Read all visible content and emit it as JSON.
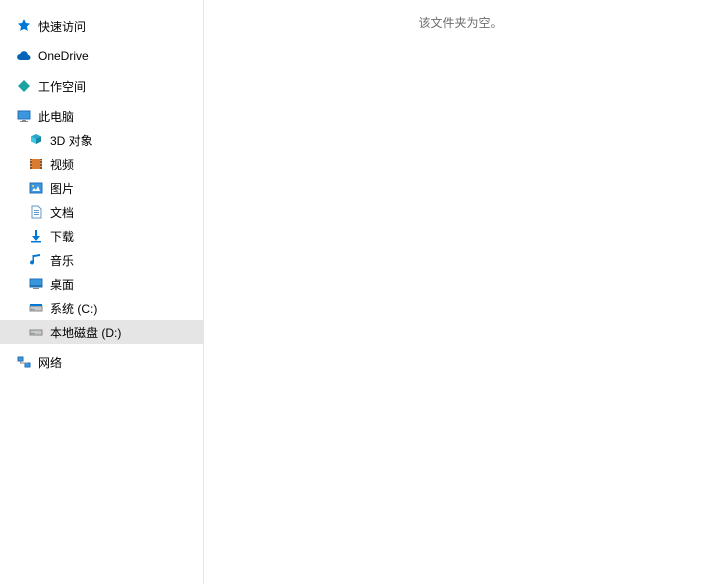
{
  "sidebar": {
    "quick_access": "快速访问",
    "onedrive": "OneDrive",
    "workspace": "工作空间",
    "this_pc": "此电脑",
    "this_pc_children": {
      "objects_3d": "3D 对象",
      "videos": "视频",
      "pictures": "图片",
      "documents": "文档",
      "downloads": "下载",
      "music": "音乐",
      "desktop": "桌面",
      "drive_c": "系统 (C:)",
      "drive_d": "本地磁盘 (D:)"
    },
    "network": "网络"
  },
  "main": {
    "empty_message": "该文件夹为空。"
  },
  "state": {
    "selected": "drive_d"
  },
  "colors": {
    "accent_blue": "#0078d7",
    "cloud_blue": "#0364b8",
    "teal": "#1aa3a3",
    "folder_yellow": "#ffd75e"
  }
}
